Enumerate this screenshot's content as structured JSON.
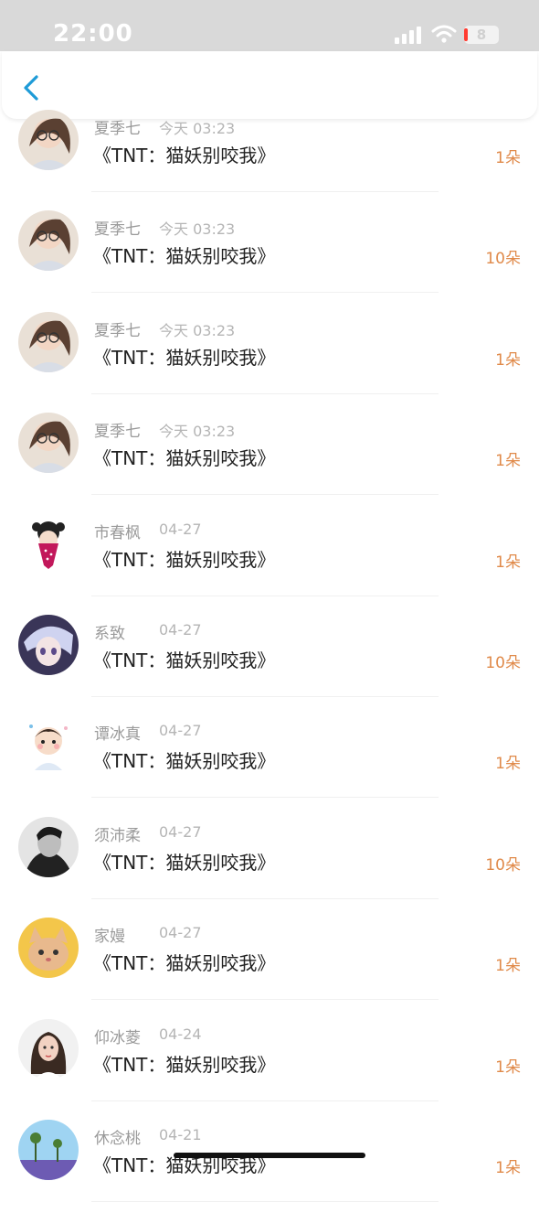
{
  "status": {
    "time": "22:00",
    "battery": "8"
  },
  "nav": {
    "back_icon": "chevron-left-icon",
    "accent": "#1e9bd7"
  },
  "colors": {
    "count": "#e08a4a",
    "name": "#9a9a9a"
  },
  "rows": [
    {
      "name": "夏季七",
      "date": "今天 03:23",
      "title": "《TNT：猫妖别咬我》",
      "count": "1朵",
      "avatar": "girl-photo-avatar"
    },
    {
      "name": "夏季七",
      "date": "今天 03:23",
      "title": "《TNT：猫妖别咬我》",
      "count": "10朵",
      "avatar": "girl-photo-avatar"
    },
    {
      "name": "夏季七",
      "date": "今天 03:23",
      "title": "《TNT：猫妖别咬我》",
      "count": "1朵",
      "avatar": "girl-photo-avatar"
    },
    {
      "name": "夏季七",
      "date": "今天 03:23",
      "title": "《TNT：猫妖别咬我》",
      "count": "1朵",
      "avatar": "girl-photo-avatar"
    },
    {
      "name": "市春枫",
      "date": "04-27",
      "title": "《TNT：猫妖别咬我》",
      "count": "1朵",
      "avatar": "masked-figure-avatar"
    },
    {
      "name": "系致",
      "date": "04-27",
      "title": "《TNT：猫妖别咬我》",
      "count": "10朵",
      "avatar": "anime-avatar"
    },
    {
      "name": "谭冰真",
      "date": "04-27",
      "title": "《TNT：猫妖别咬我》",
      "count": "1朵",
      "avatar": "cartoon-boy-avatar"
    },
    {
      "name": "须沛柔",
      "date": "04-27",
      "title": "《TNT：猫妖别咬我》",
      "count": "10朵",
      "avatar": "man-portrait-avatar"
    },
    {
      "name": "家嫚",
      "date": "04-27",
      "title": "《TNT：猫妖别咬我》",
      "count": "1朵",
      "avatar": "cat-avatar"
    },
    {
      "name": "仰冰菱",
      "date": "04-24",
      "title": "《TNT：猫妖别咬我》",
      "count": "1朵",
      "avatar": "woman-portrait-avatar"
    },
    {
      "name": "休念桃",
      "date": "04-21",
      "title": "《TNT：猫妖别咬我》",
      "count": "1朵",
      "avatar": "landscape-avatar"
    }
  ]
}
